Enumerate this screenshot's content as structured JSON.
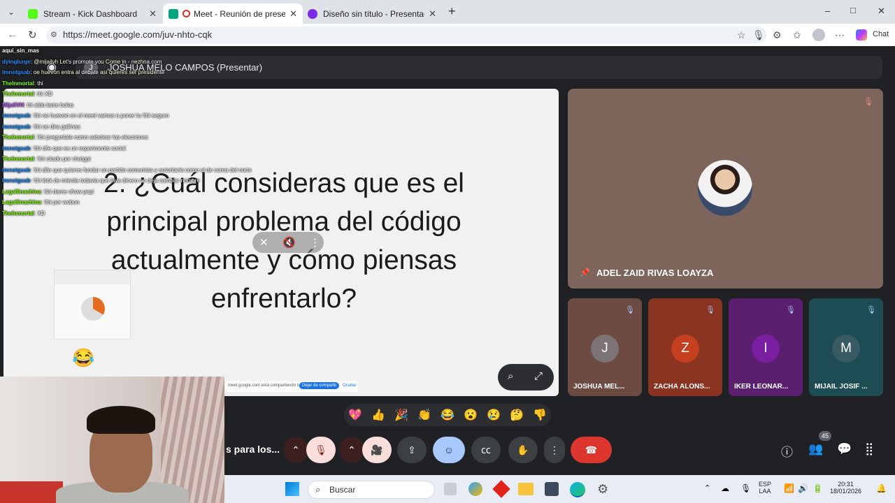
{
  "browser": {
    "tabs": [
      {
        "title": "Stream - Kick Dashboard",
        "fav_color": "#53fc18"
      },
      {
        "title": "Meet - Reunión de presentaci",
        "fav_color": "#00a67e"
      },
      {
        "title": "Diseño sin título - Presentación",
        "fav_color": "#7d2ae8"
      }
    ],
    "new_tab": "+",
    "url": "https://meet.google.com/juv-nhto-cqk",
    "chat_label": "Chat",
    "minimize": "–",
    "maximize": "□",
    "close": "✕"
  },
  "presenter": {
    "initial": "J",
    "label": "JOSHUA MELO CAMPOS (Presentar)"
  },
  "slide": {
    "text": "2. ¿Cuál consideras que es el principal problema del código actualmente y cómo piensas enfrentarlo?",
    "stop_share_text": "meet.google.com está compartiendo tu pantalla.",
    "stop_share_button": "Dejar de compartir",
    "hide_button": "Ocultar"
  },
  "chat": [
    {
      "user": "aqui_sin_mas",
      "msg": "",
      "color": "#ffffff"
    },
    {
      "user": "dyinglurge",
      "msg": ": @mijailvh Let's promote you Come in - nezhna.com",
      "color": "#1e90ff"
    },
    {
      "user": "lmnotgsab",
      "msg": ": oe huevon entra al debate así quieres ser presidente",
      "color": "#1e90ff"
    },
    {
      "user": "TheInmortal",
      "msg": ": thi",
      "color": "#7fff00"
    },
    {
      "user": "TheInmortal",
      "msg": ": thi XD",
      "color": "#7fff00"
    },
    {
      "user": "MijailVH",
      "msg": ": thi aldo lame bolas",
      "color": "#b45af2"
    },
    {
      "user": "lmnotgsab",
      "msg": ": !thi oe huevon en el meet vamos a poner tu !thi seguro",
      "color": "#1e90ff"
    },
    {
      "user": "lmnotgsab",
      "msg": ": !thi oe dira gallinas",
      "color": "#1e90ff"
    },
    {
      "user": "TheInmortal",
      "msg": ": !thi preguntale como sabotear las elecciones",
      "color": "#7fff00"
    },
    {
      "user": "lmnotgsab",
      "msg": ": !thi dile que es un experimento social",
      "color": "#1e90ff"
    },
    {
      "user": "TheInmortal",
      "msg": ": !thi citado por chatgpt",
      "color": "#7fff00"
    },
    {
      "user": "lmnotgsab",
      "msg": ": !thi dile que quieres fundar un partido comunista y autoritario como el de corea del norte",
      "color": "#1e90ff"
    },
    {
      "user": "lmnotgsab",
      "msg": ": !thi kick de mierda todavia que lava dinero no deja cambiar nombre",
      "color": "#1e90ff"
    },
    {
      "user": "Lagallinachina",
      "msg": ": !thi dame chow papi",
      "color": "#7fff00"
    },
    {
      "user": "Lagallinachina",
      "msg": ": !thi por webon",
      "color": "#7fff00"
    },
    {
      "user": "TheInmortal",
      "msg": ": XD",
      "color": "#7fff00"
    }
  ],
  "main_participant": {
    "name": "ADEL ZAID RIVAS LOAYZA"
  },
  "participants": [
    {
      "initial": "J",
      "name": "JOSHUA MEL...",
      "bg": "#6e4b42",
      "av": "#7c7474"
    },
    {
      "initial": "Z",
      "name": "ZACHA ALONS...",
      "bg": "#8a3320",
      "av": "#c5401f"
    },
    {
      "initial": "I",
      "name": "IKER LEONAR...",
      "bg": "#5a1f6e",
      "av": "#7b1fa2"
    },
    {
      "initial": "M",
      "name": "MIJAIL JOSIF ...",
      "bg": "#1d4c54",
      "av": "#385a62"
    }
  ],
  "reactions": [
    "💖",
    "👍",
    "🎉",
    "👏",
    "😂",
    "😮",
    "😢",
    "🤔",
    "👎"
  ],
  "meeting": {
    "name_fragment": "s para los...",
    "participant_count": "45"
  },
  "taskbar": {
    "search_placeholder": "Buscar",
    "lang_top": "ESP",
    "lang_bottom": "LAA",
    "time": "20:31",
    "date": "18/01/2026"
  },
  "overlay_emoji": "😂"
}
